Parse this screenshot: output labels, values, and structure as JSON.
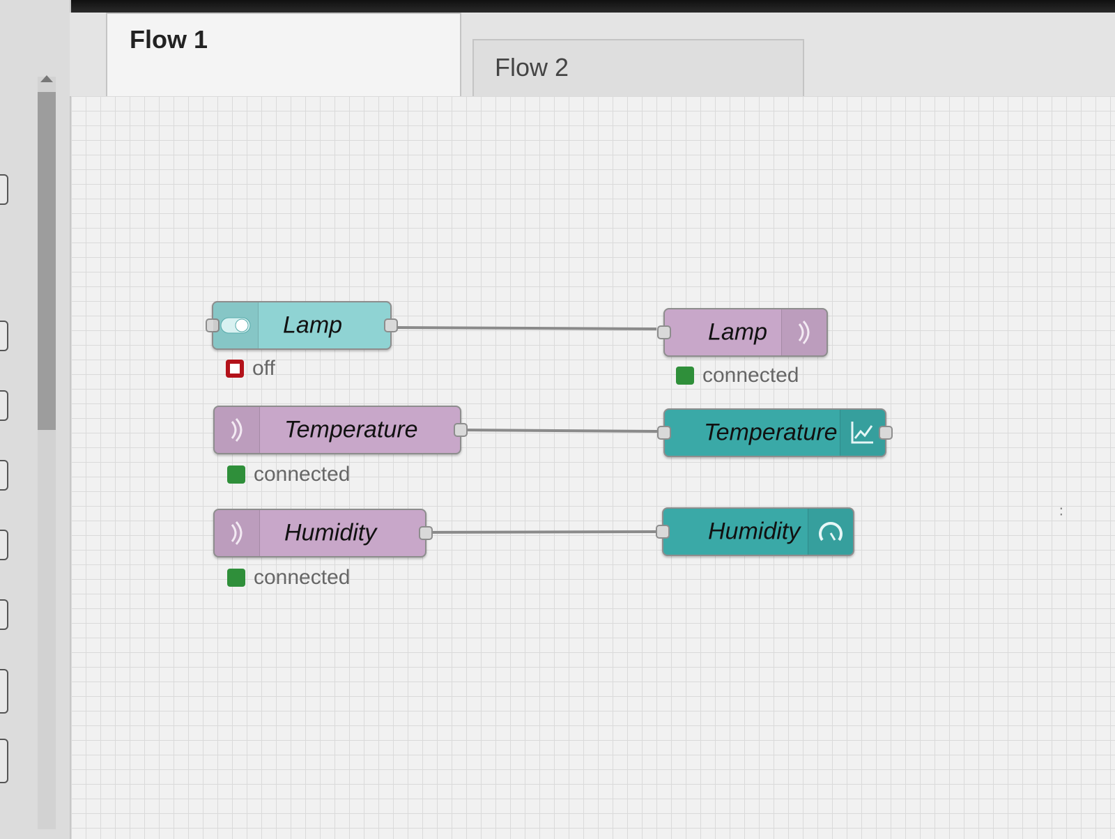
{
  "tabs": [
    {
      "label": "Flow 1"
    },
    {
      "label": "Flow 2"
    }
  ],
  "colors": {
    "switch_node": "#8fd3d3",
    "mqtt_node": "#c8a7c9",
    "dashboard_node": "#3aa9a7",
    "status_connected": "#2f8f3a",
    "status_off": "#b3121a",
    "wire": "#8a8a8a"
  },
  "nodes": {
    "lamp_switch": {
      "label": "Lamp",
      "icon": "toggle-switch-icon",
      "status": "off"
    },
    "temperature_in": {
      "label": "Temperature",
      "icon": "mqtt-icon",
      "status": "connected"
    },
    "humidity_in": {
      "label": "Humidity",
      "icon": "mqtt-icon",
      "status": "connected"
    },
    "lamp_out": {
      "label": "Lamp",
      "icon": "mqtt-icon",
      "status": "connected"
    },
    "temperature_chart": {
      "label": "Temperature",
      "icon": "chart-icon"
    },
    "humidity_gauge": {
      "label": "Humidity",
      "icon": "gauge-icon"
    }
  }
}
